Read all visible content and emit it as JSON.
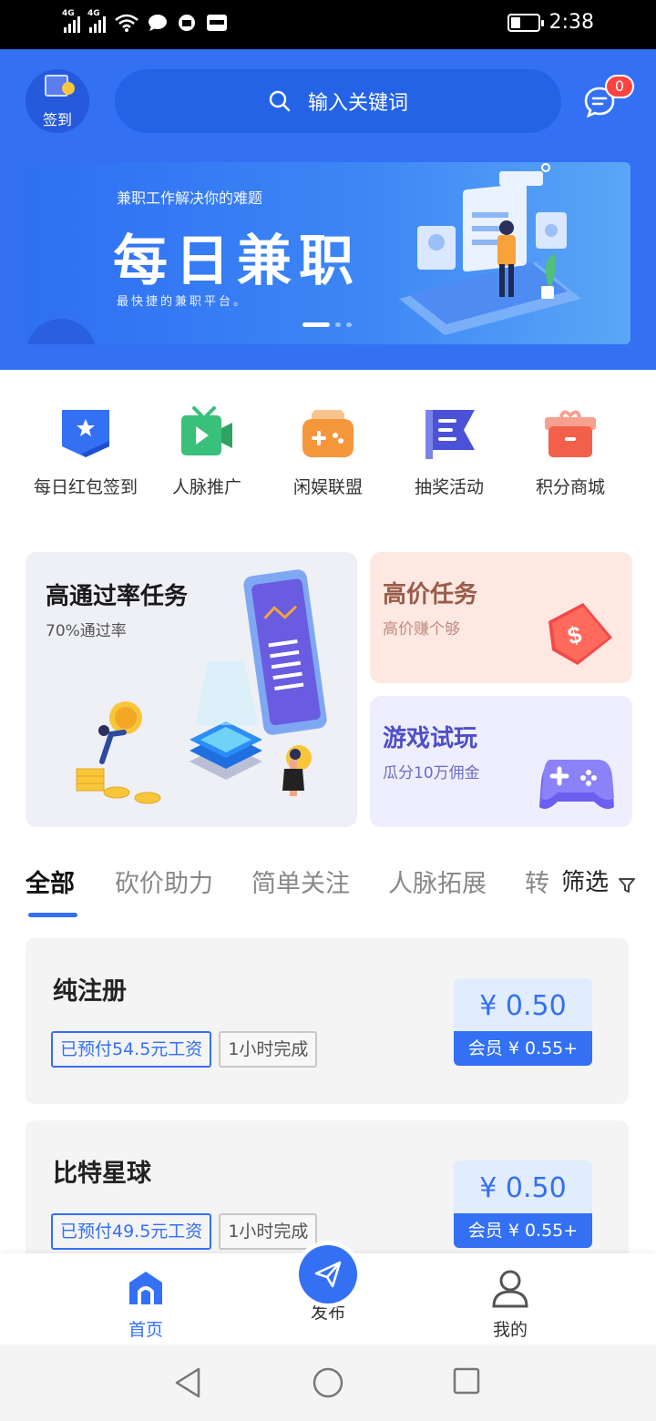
{
  "status_bar": {
    "signal1": "4G",
    "signal2": "4G",
    "time": "2:38",
    "battery_level": 0.35
  },
  "header": {
    "signin_label": "签到",
    "search_placeholder": "输入关键词",
    "message_badge": "0"
  },
  "banner": {
    "subtitle": "兼职工作解决你的难题",
    "title": "每日兼职",
    "tagline": "最快捷的兼职平台。",
    "active_slide": 1,
    "slide_count": 3
  },
  "quick_menu": [
    {
      "label": "每日红包签到",
      "icon": "star-flag-icon",
      "color": "#3370f4"
    },
    {
      "label": "人脉推广",
      "icon": "tv-play-icon",
      "color": "#39c07a"
    },
    {
      "label": "闲娱联盟",
      "icon": "gamepad-icon",
      "color": "#f6963b"
    },
    {
      "label": "抽奖活动",
      "icon": "banner-flag-icon",
      "color": "#4b52d8"
    },
    {
      "label": "积分商城",
      "icon": "gift-box-icon",
      "color": "#f2604b"
    }
  ],
  "features": {
    "big": {
      "title": "高通过率任务",
      "subtitle": "70%通过率"
    },
    "high_price": {
      "title": "高价任务",
      "subtitle": "高价赚个够"
    },
    "game": {
      "title": "游戏试玩",
      "subtitle": "瓜分10万佣金"
    }
  },
  "tabs": {
    "items": [
      "全部",
      "砍价助力",
      "简单关注",
      "人脉拓展",
      "转"
    ],
    "active_index": 0,
    "filter_label": "筛选"
  },
  "tasks": [
    {
      "name": "纯注册",
      "tag_paid": "已预付54.5元工资",
      "tag_time": "1小时完成",
      "price": "¥ 0.50",
      "vip_price": "会员 ¥ 0.55+"
    },
    {
      "name": "比特星球",
      "tag_paid": "已预付49.5元工资",
      "tag_time": "1小时完成",
      "price": "¥ 0.50",
      "vip_price": "会员 ¥ 0.55+"
    }
  ],
  "bottom_nav": {
    "home": "首页",
    "publish": "发布",
    "me": "我的",
    "active": "home"
  },
  "colors": {
    "primary": "#3370f4",
    "header_bg": "#3370f4",
    "badge": "#ff4340"
  }
}
